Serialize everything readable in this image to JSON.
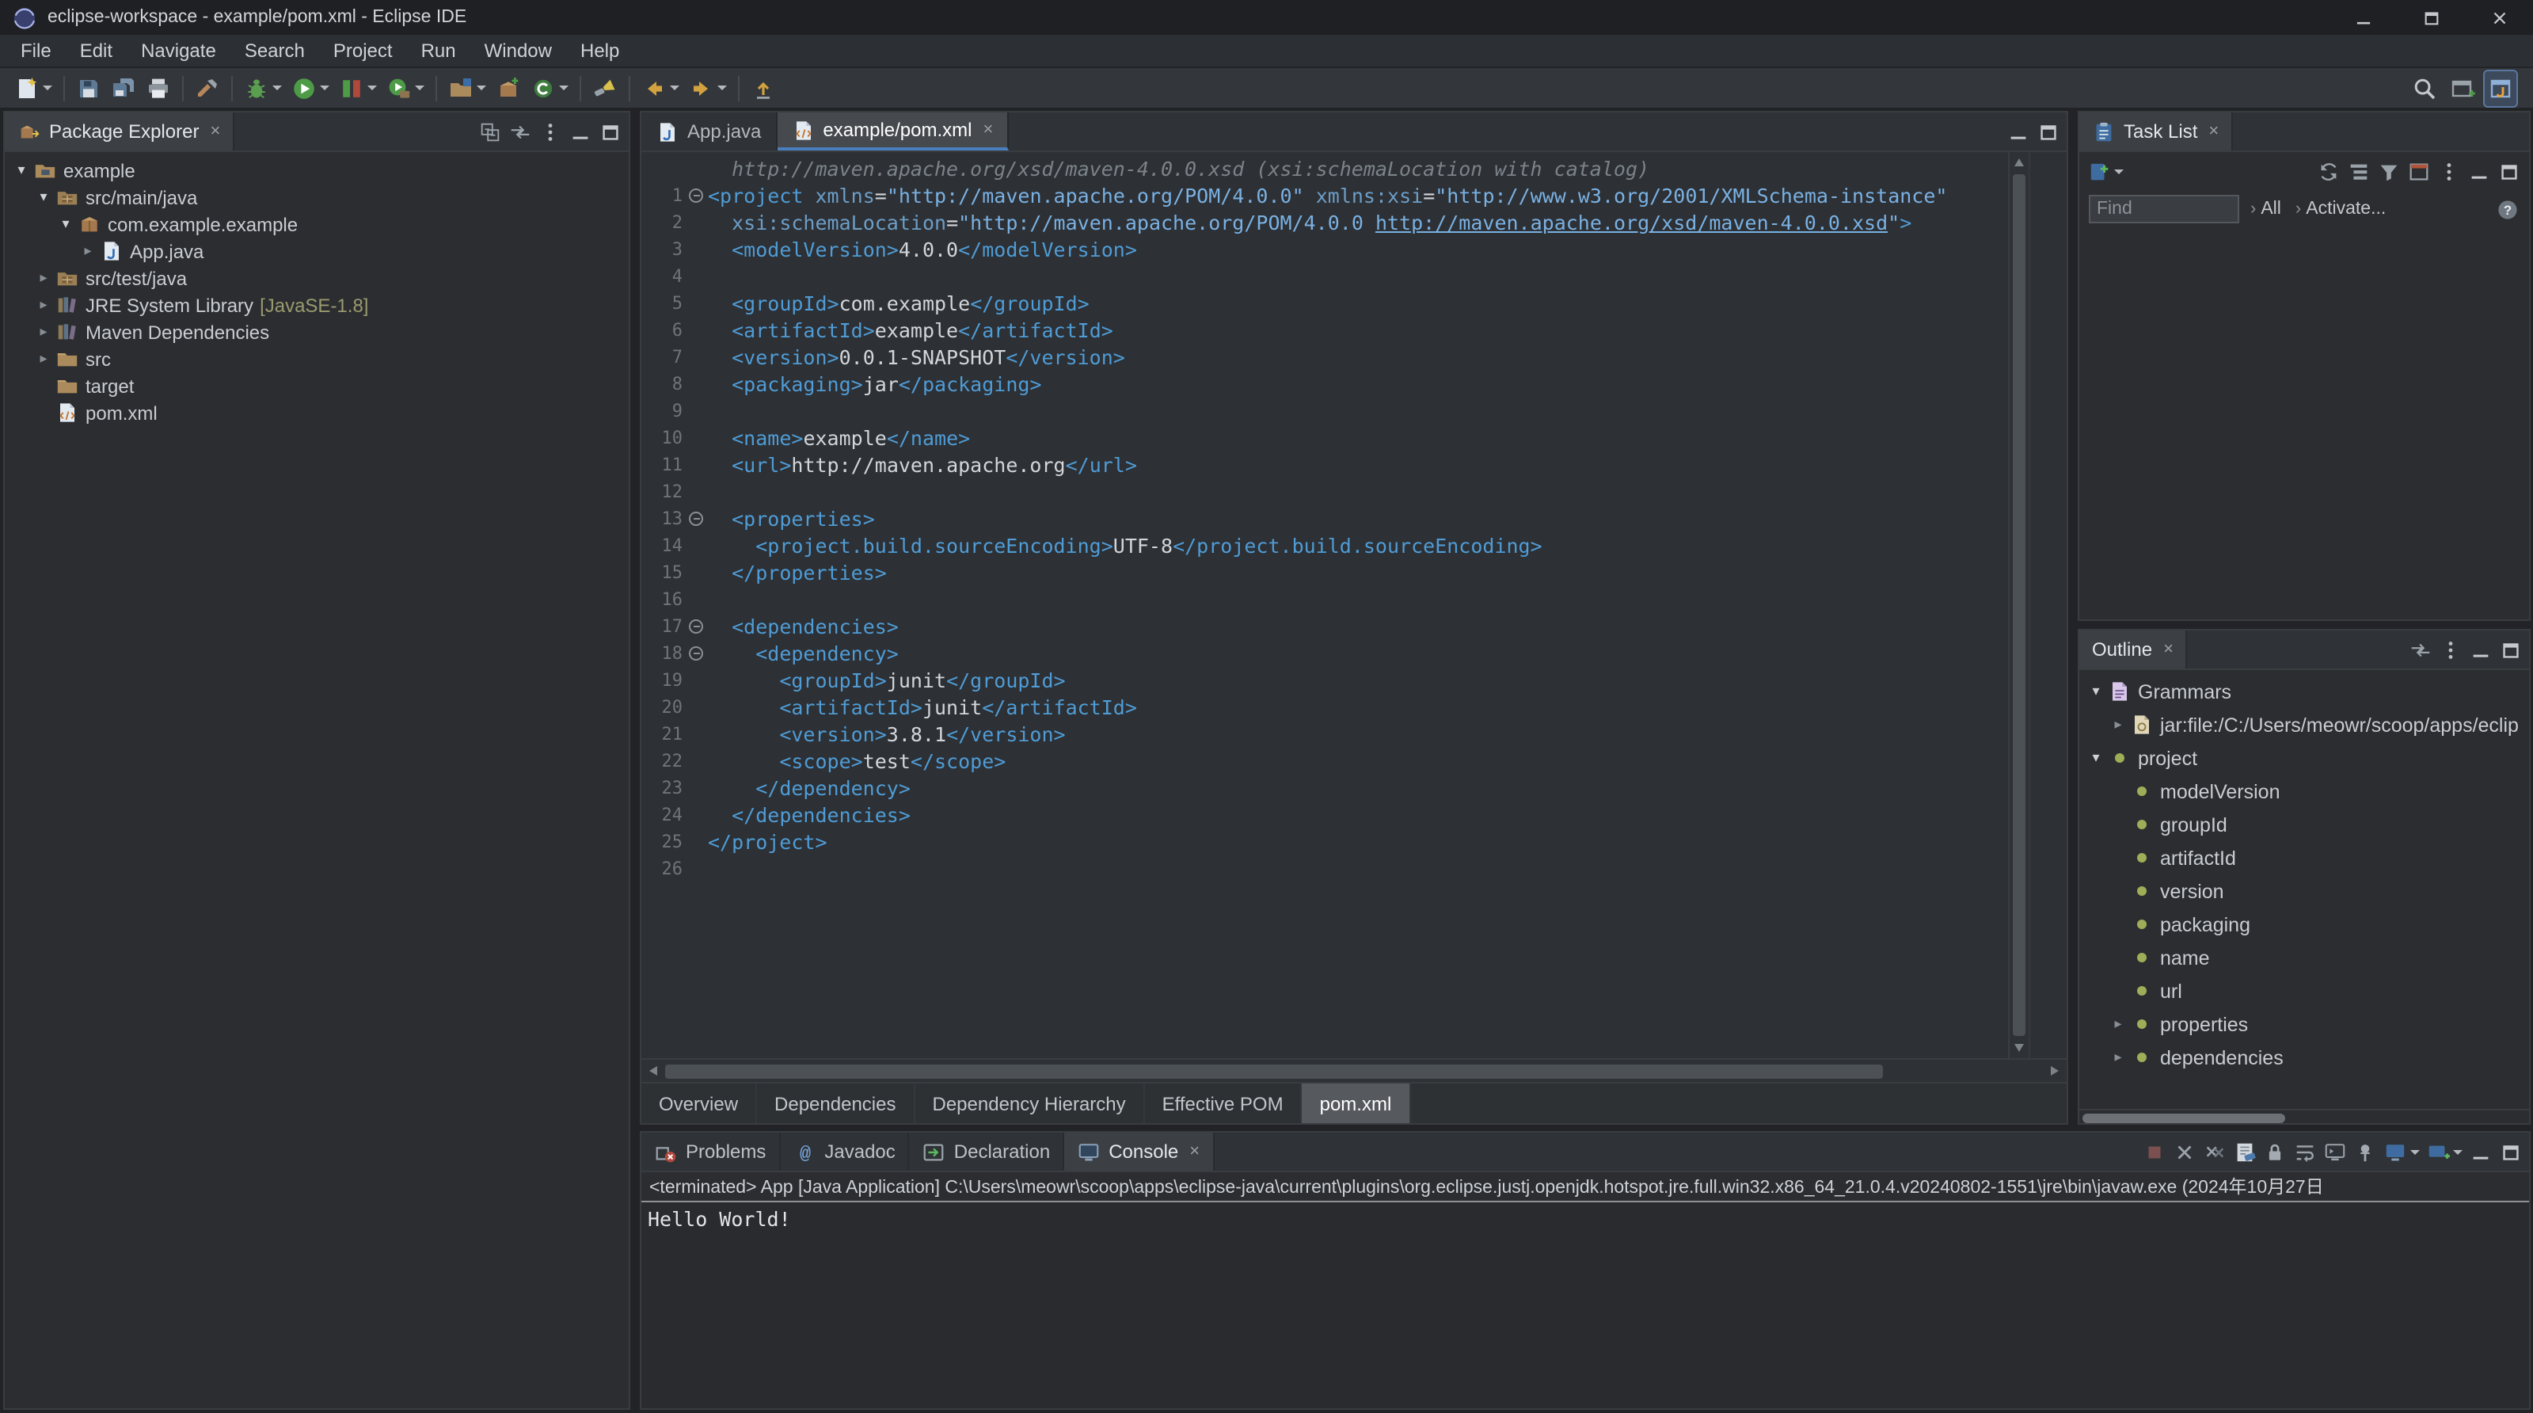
{
  "titlebar": {
    "title": "eclipse-workspace - example/pom.xml - Eclipse IDE",
    "controls": [
      {
        "name": "minimize"
      },
      {
        "name": "maximize"
      },
      {
        "name": "close"
      }
    ]
  },
  "menubar": [
    "File",
    "Edit",
    "Navigate",
    "Search",
    "Project",
    "Run",
    "Window",
    "Help"
  ],
  "toolbar": {
    "groups": [
      [
        {
          "name": "new-wizard",
          "caret": true
        }
      ],
      [
        {
          "name": "save"
        },
        {
          "name": "save-all"
        },
        {
          "name": "print"
        }
      ],
      [
        {
          "name": "build-all"
        }
      ],
      [
        {
          "name": "debug",
          "caret": true
        },
        {
          "name": "run",
          "caret": true
        },
        {
          "name": "coverage",
          "caret": true
        },
        {
          "name": "external-tools",
          "caret": true
        }
      ],
      [
        {
          "name": "new-java-project",
          "caret": true
        },
        {
          "name": "new-package"
        },
        {
          "name": "new-class",
          "caret": true
        }
      ],
      [
        {
          "name": "search-flashlight"
        }
      ],
      [
        {
          "name": "back",
          "caret": true
        },
        {
          "name": "forward",
          "caret": true
        }
      ],
      [
        {
          "name": "last-edit-location"
        }
      ]
    ],
    "right": [
      {
        "name": "quick-search"
      },
      {
        "name": "open-perspective"
      },
      {
        "name": "java-perspective",
        "active": true
      }
    ]
  },
  "package_explorer": {
    "title": "Package Explorer",
    "tab_icon": "package-explorer",
    "header_icons": [
      {
        "name": "collapse-all"
      },
      {
        "name": "link-with-editor"
      },
      {
        "name": "view-menu"
      },
      {
        "name": "minimize"
      },
      {
        "name": "maximize"
      }
    ],
    "tree": [
      {
        "label": "example",
        "icon": "project",
        "depth": 0,
        "arrow": "down"
      },
      {
        "label": "src/main/java",
        "icon": "source-folder",
        "depth": 1,
        "arrow": "down"
      },
      {
        "label": "com.example.example",
        "icon": "package",
        "depth": 2,
        "arrow": "down"
      },
      {
        "label": "App.java",
        "icon": "java-file",
        "depth": 3,
        "arrow": "right"
      },
      {
        "label": "src/test/java",
        "icon": "source-folder",
        "depth": 1,
        "arrow": "right"
      },
      {
        "label": "JRE System Library",
        "suffix": "[JavaSE-1.8]",
        "icon": "library",
        "depth": 1,
        "arrow": "right"
      },
      {
        "label": "Maven Dependencies",
        "icon": "library",
        "depth": 1,
        "arrow": "right"
      },
      {
        "label": "src",
        "icon": "folder",
        "depth": 1,
        "arrow": "right"
      },
      {
        "label": "target",
        "icon": "folder",
        "depth": 1,
        "arrow": "none"
      },
      {
        "label": "pom.xml",
        "icon": "xml-file",
        "depth": 1,
        "arrow": "none"
      }
    ]
  },
  "editor": {
    "tabs": [
      {
        "label": "App.java",
        "icon": "java-file",
        "active": false,
        "closable": false
      },
      {
        "label": "example/pom.xml",
        "icon": "xml-file",
        "active": true,
        "closable": true
      }
    ],
    "window_icons": [
      {
        "name": "minimize"
      },
      {
        "name": "maximize"
      }
    ],
    "mining": "  http://maven.apache.org/xsd/maven-4.0.0.xsd (xsi:schemaLocation with catalog)",
    "lines": [
      {
        "n": 1,
        "fold": true,
        "seg": [
          [
            "g",
            "<project"
          ],
          [
            "p",
            " "
          ],
          [
            "a",
            "xmlns"
          ],
          [
            "p",
            "="
          ],
          [
            "s",
            "\"http://maven.apache.org/POM/4.0.0\""
          ],
          [
            "p",
            " "
          ],
          [
            "a",
            "xmlns:xsi"
          ],
          [
            "p",
            "="
          ],
          [
            "s",
            "\"http://www.w3.org/2001/XMLSchema-instance\""
          ]
        ]
      },
      {
        "n": 2,
        "seg": [
          [
            "p",
            "  "
          ],
          [
            "a",
            "xsi:schemaLocation"
          ],
          [
            "p",
            "="
          ],
          [
            "s",
            "\"http://maven.apache.org/POM/4.0.0 "
          ],
          [
            "l",
            "http://maven.apache.org/xsd/maven-4.0.0.xsd"
          ],
          [
            "s",
            "\""
          ],
          [
            "g",
            ">"
          ]
        ]
      },
      {
        "n": 3,
        "seg": [
          [
            "p",
            "  "
          ],
          [
            "g",
            "<modelVersion>"
          ],
          [
            "p",
            "4.0.0"
          ],
          [
            "g",
            "</modelVersion>"
          ]
        ]
      },
      {
        "n": 4,
        "seg": []
      },
      {
        "n": 5,
        "seg": [
          [
            "p",
            "  "
          ],
          [
            "g",
            "<groupId>"
          ],
          [
            "p",
            "com.example"
          ],
          [
            "g",
            "</groupId>"
          ]
        ]
      },
      {
        "n": 6,
        "seg": [
          [
            "p",
            "  "
          ],
          [
            "g",
            "<artifactId>"
          ],
          [
            "p",
            "example"
          ],
          [
            "g",
            "</artifactId>"
          ]
        ]
      },
      {
        "n": 7,
        "seg": [
          [
            "p",
            "  "
          ],
          [
            "g",
            "<version>"
          ],
          [
            "p",
            "0.0.1-SNAPSHOT"
          ],
          [
            "g",
            "</version>"
          ]
        ]
      },
      {
        "n": 8,
        "seg": [
          [
            "p",
            "  "
          ],
          [
            "g",
            "<packaging>"
          ],
          [
            "p",
            "jar"
          ],
          [
            "g",
            "</packaging>"
          ]
        ]
      },
      {
        "n": 9,
        "seg": []
      },
      {
        "n": 10,
        "seg": [
          [
            "p",
            "  "
          ],
          [
            "g",
            "<name>"
          ],
          [
            "p",
            "example"
          ],
          [
            "g",
            "</name>"
          ]
        ]
      },
      {
        "n": 11,
        "seg": [
          [
            "p",
            "  "
          ],
          [
            "g",
            "<url>"
          ],
          [
            "p",
            "http://maven.apache.org"
          ],
          [
            "g",
            "</url>"
          ]
        ]
      },
      {
        "n": 12,
        "seg": []
      },
      {
        "n": 13,
        "fold": true,
        "seg": [
          [
            "p",
            "  "
          ],
          [
            "g",
            "<properties>"
          ]
        ]
      },
      {
        "n": 14,
        "seg": [
          [
            "p",
            "    "
          ],
          [
            "g",
            "<project.build.sourceEncoding>"
          ],
          [
            "p",
            "UTF-8"
          ],
          [
            "g",
            "</project.build.sourceEncoding>"
          ]
        ]
      },
      {
        "n": 15,
        "seg": [
          [
            "p",
            "  "
          ],
          [
            "g",
            "</properties>"
          ]
        ]
      },
      {
        "n": 16,
        "seg": []
      },
      {
        "n": 17,
        "fold": true,
        "seg": [
          [
            "p",
            "  "
          ],
          [
            "g",
            "<dependencies>"
          ]
        ]
      },
      {
        "n": 18,
        "fold": true,
        "seg": [
          [
            "p",
            "    "
          ],
          [
            "g",
            "<dependency>"
          ]
        ]
      },
      {
        "n": 19,
        "seg": [
          [
            "p",
            "      "
          ],
          [
            "g",
            "<groupId>"
          ],
          [
            "p",
            "junit"
          ],
          [
            "g",
            "</groupId>"
          ]
        ]
      },
      {
        "n": 20,
        "seg": [
          [
            "p",
            "      "
          ],
          [
            "g",
            "<artifactId>"
          ],
          [
            "p",
            "junit"
          ],
          [
            "g",
            "</artifactId>"
          ]
        ]
      },
      {
        "n": 21,
        "seg": [
          [
            "p",
            "      "
          ],
          [
            "g",
            "<version>"
          ],
          [
            "p",
            "3.8.1"
          ],
          [
            "g",
            "</version>"
          ]
        ]
      },
      {
        "n": 22,
        "seg": [
          [
            "p",
            "      "
          ],
          [
            "g",
            "<scope>"
          ],
          [
            "p",
            "test"
          ],
          [
            "g",
            "</scope>"
          ]
        ]
      },
      {
        "n": 23,
        "seg": [
          [
            "p",
            "    "
          ],
          [
            "g",
            "</dependency>"
          ]
        ]
      },
      {
        "n": 24,
        "seg": [
          [
            "p",
            "  "
          ],
          [
            "g",
            "</dependencies>"
          ]
        ]
      },
      {
        "n": 25,
        "seg": [
          [
            "g",
            "</project>"
          ]
        ]
      },
      {
        "n": 26,
        "seg": []
      }
    ],
    "bottom_tabs": [
      {
        "label": "Overview"
      },
      {
        "label": "Dependencies"
      },
      {
        "label": "Dependency Hierarchy"
      },
      {
        "label": "Effective POM"
      },
      {
        "label": "pom.xml",
        "active": true
      }
    ]
  },
  "task_list": {
    "title": "Task List",
    "tab_icon": "task-list",
    "toolbar_left": [
      {
        "name": "new-task",
        "caret": true
      }
    ],
    "toolbar_right": [
      {
        "name": "synchronize"
      },
      {
        "name": "categorized"
      },
      {
        "name": "filter-completed"
      },
      {
        "name": "focus-workweek"
      },
      {
        "name": "view-menu"
      },
      {
        "name": "minimize"
      },
      {
        "name": "maximize"
      }
    ],
    "find": {
      "placeholder": "Find"
    },
    "links": [
      "All",
      "Activate..."
    ],
    "help_icon": "help"
  },
  "outline": {
    "title": "Outline",
    "header_icons": [
      {
        "name": "link-with-editor"
      },
      {
        "name": "view-menu"
      },
      {
        "name": "minimize"
      },
      {
        "name": "maximize"
      }
    ],
    "tree": [
      {
        "label": "Grammars",
        "icon": "grammar",
        "depth": 0,
        "arrow": "down"
      },
      {
        "label": "jar:file:/C:/Users/meowr/scoop/apps/eclip",
        "icon": "jar",
        "depth": 1,
        "arrow": "right"
      },
      {
        "label": "project",
        "icon": "xml-element",
        "depth": 0,
        "arrow": "down"
      },
      {
        "label": "modelVersion",
        "icon": "xml-element",
        "depth": 1,
        "arrow": "none"
      },
      {
        "label": "groupId",
        "icon": "xml-element",
        "depth": 1,
        "arrow": "none"
      },
      {
        "label": "artifactId",
        "icon": "xml-element",
        "depth": 1,
        "arrow": "none"
      },
      {
        "label": "version",
        "icon": "xml-element",
        "depth": 1,
        "arrow": "none"
      },
      {
        "label": "packaging",
        "icon": "xml-element",
        "depth": 1,
        "arrow": "none"
      },
      {
        "label": "name",
        "icon": "xml-element",
        "depth": 1,
        "arrow": "none"
      },
      {
        "label": "url",
        "icon": "xml-element",
        "depth": 1,
        "arrow": "none"
      },
      {
        "label": "properties",
        "icon": "xml-element",
        "depth": 1,
        "arrow": "right"
      },
      {
        "label": "dependencies",
        "icon": "xml-element",
        "depth": 1,
        "arrow": "right"
      }
    ]
  },
  "console": {
    "tabs": [
      {
        "label": "Problems",
        "icon": "problems"
      },
      {
        "label": "Javadoc",
        "icon": "javadoc"
      },
      {
        "label": "Declaration",
        "icon": "declaration"
      },
      {
        "label": "Console",
        "icon": "console",
        "active": true,
        "closable": true
      }
    ],
    "toolbar_icons": [
      {
        "name": "terminate"
      },
      {
        "name": "remove-launch"
      },
      {
        "name": "remove-all-launches"
      },
      {
        "name": "clear-console"
      },
      {
        "name": "scroll-lock"
      },
      {
        "name": "word-wrap"
      },
      {
        "name": "show-stdout"
      },
      {
        "name": "pin-console"
      },
      {
        "name": "display-selected-console",
        "caret": true
      },
      {
        "name": "open-console",
        "caret": true
      },
      {
        "name": "minimize"
      },
      {
        "name": "maximize"
      }
    ],
    "status": "<terminated> App [Java Application] C:\\Users\\meowr\\scoop\\apps\\eclipse-java\\current\\plugins\\org.eclipse.justj.openjdk.hotspot.jre.full.win32.x86_64_21.0.4.v20240802-1551\\jre\\bin\\javaw.exe (2024年10月27日",
    "output": "Hello World!"
  }
}
